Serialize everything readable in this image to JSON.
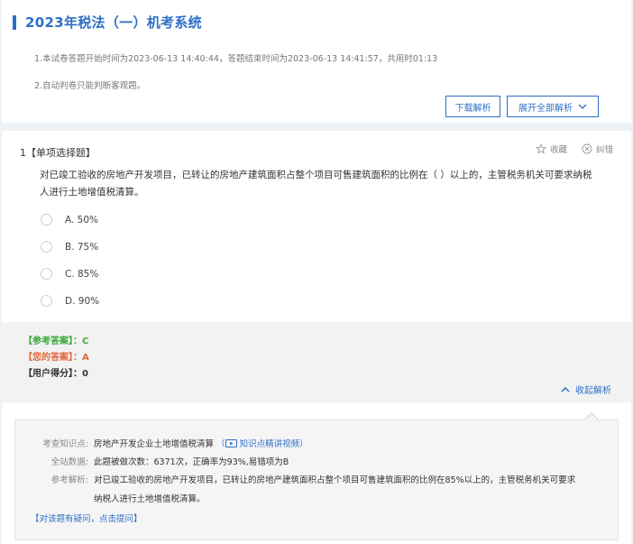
{
  "header": {
    "title": "2023年税法（一）机考系统",
    "info_line1": "1.本试卷答题开始时间为2023-06-13 14:40:44，答题结束时间为2023-06-13 14:41:57，共用时01:13",
    "info_line2": "2.自动判卷只能判断客观题。",
    "download_label": "下载解析",
    "expand_label": "展开全部解析"
  },
  "question": {
    "number_type": "1【单项选择题】",
    "favorite_label": "收藏",
    "report_label": "纠错",
    "text": "对已竣工验收的房地产开发项目，已转让的房地产建筑面积占整个项目可售建筑面积的比例在（   ）以上的，主管税务机关可要求纳税人进行土地增值税清算。",
    "options": [
      {
        "label": "A.  50%"
      },
      {
        "label": "B.  75%"
      },
      {
        "label": "C.  85%"
      },
      {
        "label": "D.  90%"
      }
    ]
  },
  "answers": {
    "reference": "【参考答案】：C",
    "mine": "【您的答案】：A",
    "score": "【用户得分】：0",
    "collapse_label": "收起解析"
  },
  "analysis": {
    "point_label": "考查知识点:",
    "point_value": "房地产开发企业土地增值税清算",
    "video_link": "知识点精讲视频",
    "stats_label": "全站数据:",
    "stats_value": "此题被做次数：6371次，正确率为93%,易错项为B",
    "ref_label": "参考解析:",
    "ref_line1": "对已竣工验收的房地产开发项目，已转让的房地产建筑面积占整个项目可售建筑面积的比例在85%以上的，主管税务机关可要求",
    "ref_line2": "纳税人进行土地增值税清算。",
    "ask_link": "【对该题有疑问，点击提问】"
  },
  "colors": {
    "accent": "#2d6fc7",
    "correct": "#3aa83a",
    "wrong": "#e2673d"
  }
}
